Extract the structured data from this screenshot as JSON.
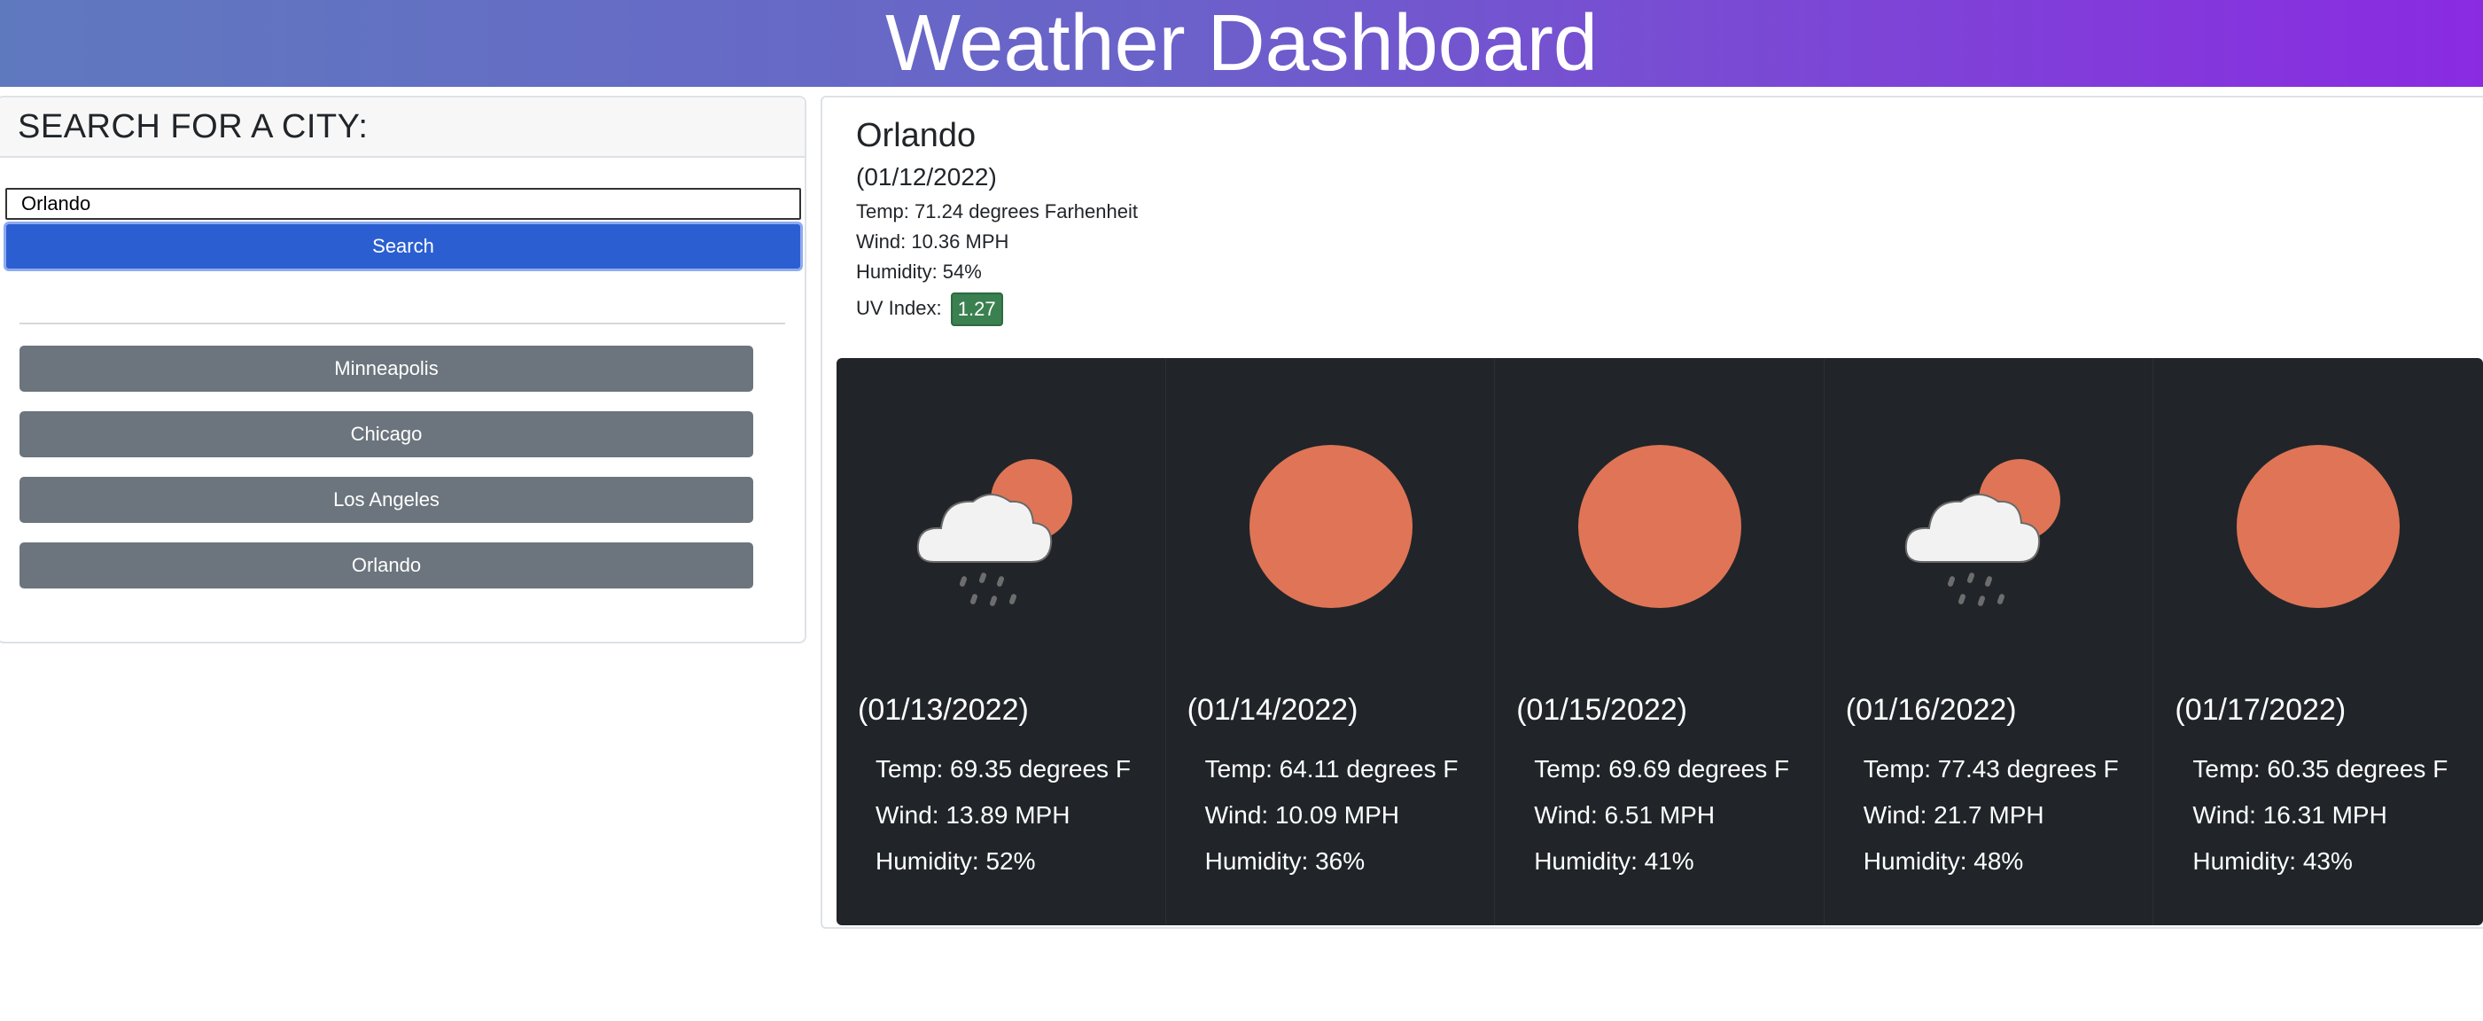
{
  "header": {
    "title": "Weather Dashboard"
  },
  "search": {
    "heading": "SEARCH FOR A CITY:",
    "input_value": "Orlando",
    "button_label": "Search"
  },
  "history": [
    {
      "label": "Minneapolis"
    },
    {
      "label": "Chicago"
    },
    {
      "label": "Los Angeles"
    },
    {
      "label": "Orlando"
    }
  ],
  "current": {
    "city": "Orlando",
    "date": "(01/12/2022)",
    "temp": "Temp: 71.24 degrees Farhenheit",
    "wind": "Wind: 10.36 MPH",
    "humidity": "Humidity: 54%",
    "uv_label": "UV Index:",
    "uv_value": "1.27",
    "uv_color": "#3a8050"
  },
  "forecast": [
    {
      "date": "(01/13/2022)",
      "icon": "rain-cloud-sun-icon",
      "temp": "Temp: 69.35 degrees F",
      "wind": "Wind: 13.89 MPH",
      "humidity": "Humidity: 52%"
    },
    {
      "date": "(01/14/2022)",
      "icon": "sun-icon",
      "temp": "Temp: 64.11 degrees F",
      "wind": "Wind: 10.09 MPH",
      "humidity": "Humidity: 36%"
    },
    {
      "date": "(01/15/2022)",
      "icon": "sun-icon",
      "temp": "Temp: 69.69 degrees F",
      "wind": "Wind: 6.51 MPH",
      "humidity": "Humidity: 41%"
    },
    {
      "date": "(01/16/2022)",
      "icon": "rain-cloud-sun-icon",
      "temp": "Temp: 77.43 degrees F",
      "wind": "Wind: 21.7 MPH",
      "humidity": "Humidity: 48%"
    },
    {
      "date": "(01/17/2022)",
      "icon": "sun-icon",
      "temp": "Temp: 60.35 degrees F",
      "wind": "Wind: 16.31 MPH",
      "humidity": "Humidity: 43%"
    }
  ],
  "colors": {
    "header_gradient_start": "#5f79bf",
    "header_gradient_end": "#8a2be2",
    "search_button": "#2b5fd1",
    "history_button": "#6c757d",
    "forecast_bg": "#212529",
    "sun": "#df7556"
  }
}
